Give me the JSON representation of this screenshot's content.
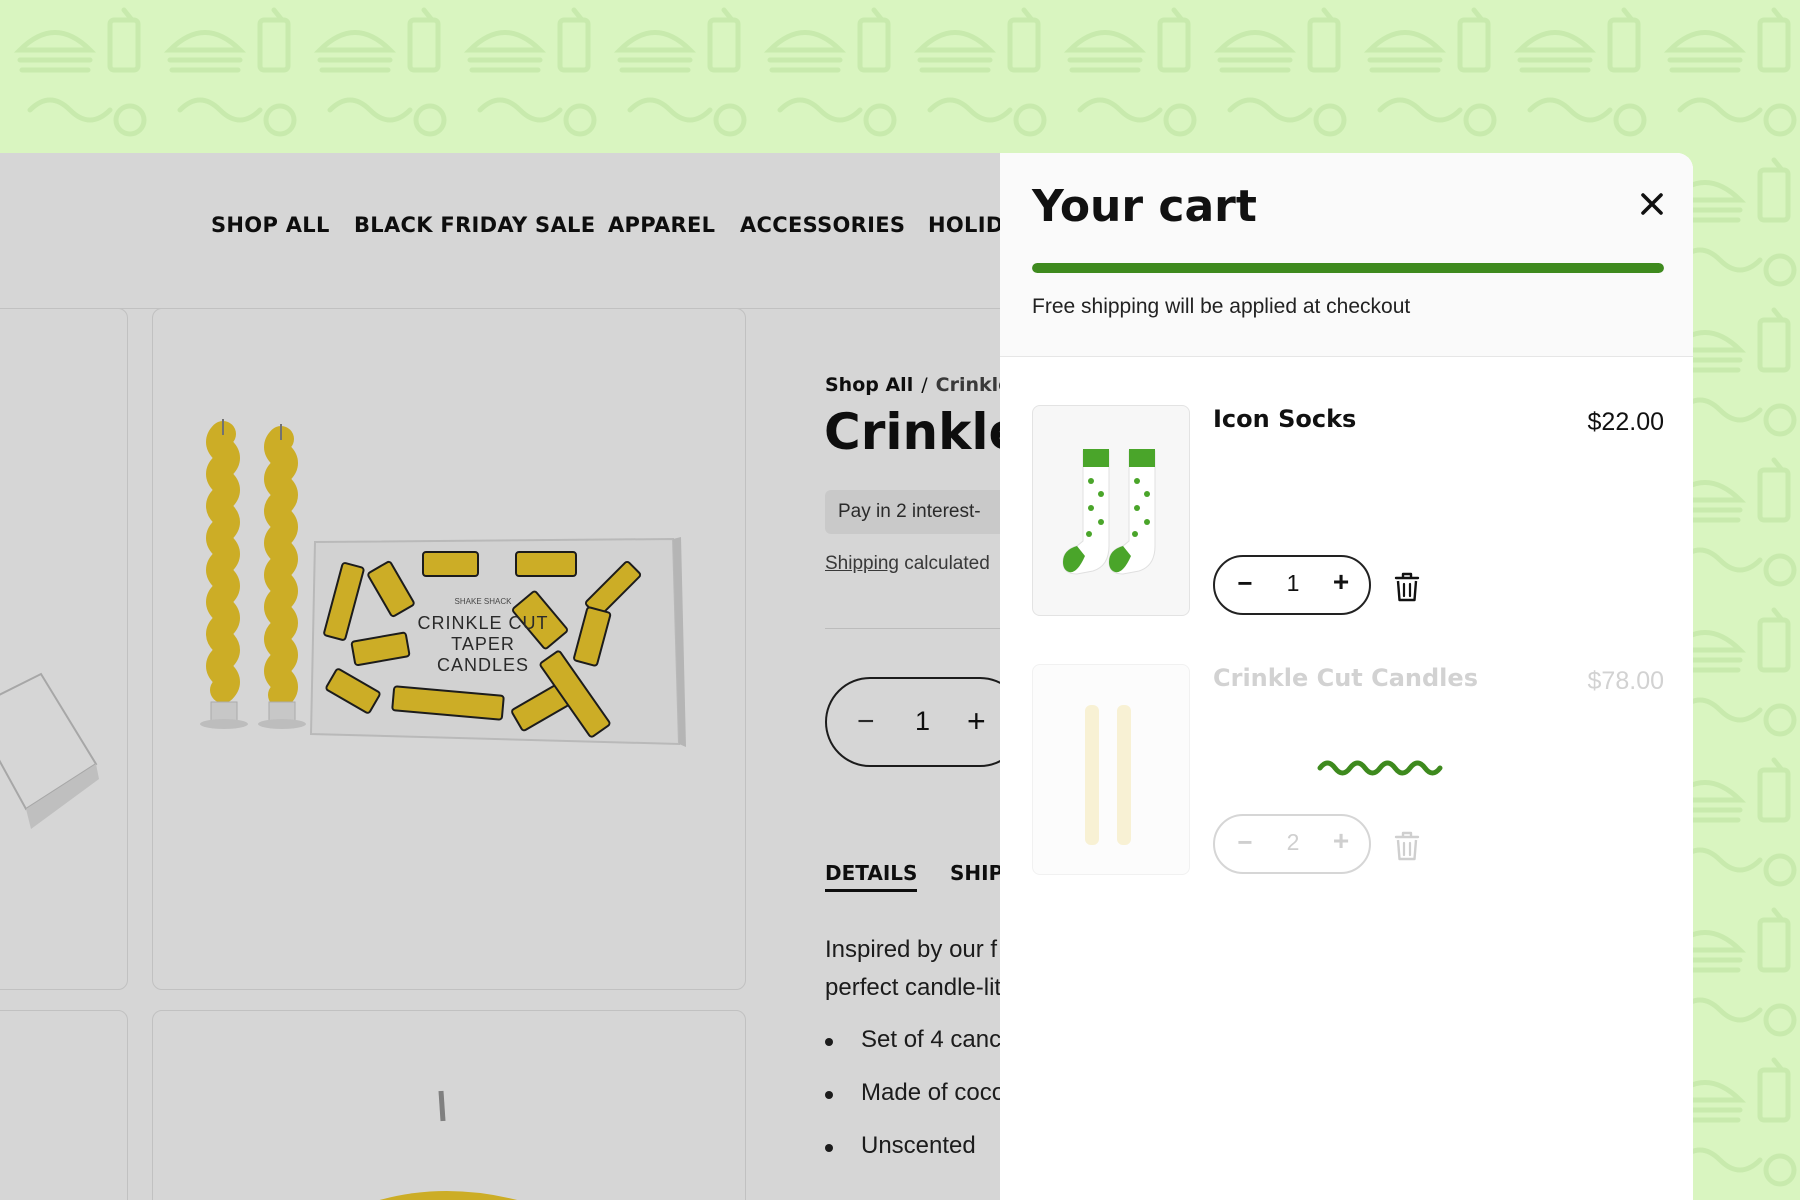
{
  "colors": {
    "background": "#d9f5c0",
    "pattern": "#c7ebab",
    "accent_green": "#3e8a1e",
    "overlay": "rgba(0,0,0,0.16)"
  },
  "nav": {
    "items": [
      "SHOP ALL",
      "BLACK FRIDAY SALE",
      "APPAREL",
      "ACCESSORIES",
      "HOLID"
    ]
  },
  "product": {
    "image_box_text": [
      "CRINKLE CUT",
      "TAPER",
      "CANDLES"
    ],
    "box_brand": "SHAKE SHACK",
    "breadcrumb": {
      "root": "Shop All",
      "separator": "/",
      "current": "Crinkle"
    },
    "title": "Crinkle",
    "pay_text": "Pay in 2 interest-",
    "shipping_link": "Shipping",
    "shipping_text": "calculated",
    "quantity": {
      "minus": "−",
      "value": "1",
      "plus": "+"
    },
    "tabs": [
      "DETAILS",
      "SHIP"
    ],
    "description": [
      "Inspired by our f",
      "perfect candle-lit"
    ],
    "bullets": [
      "Set of 4 canc",
      "Made of coco",
      "Unscented"
    ]
  },
  "cart": {
    "title": "Your cart",
    "close_icon": "close-icon",
    "shipping_progress": 1.0,
    "shipping_message": "Free shipping will be applied at checkout",
    "items": [
      {
        "name": "Icon Socks",
        "price": "$22.00",
        "qty": "1",
        "minus": "−",
        "plus": "+",
        "state": "active"
      },
      {
        "name": "Crinkle Cut Candles",
        "price": "$78.00",
        "qty": "2",
        "minus": "−",
        "plus": "+",
        "state": "updating"
      }
    ]
  }
}
